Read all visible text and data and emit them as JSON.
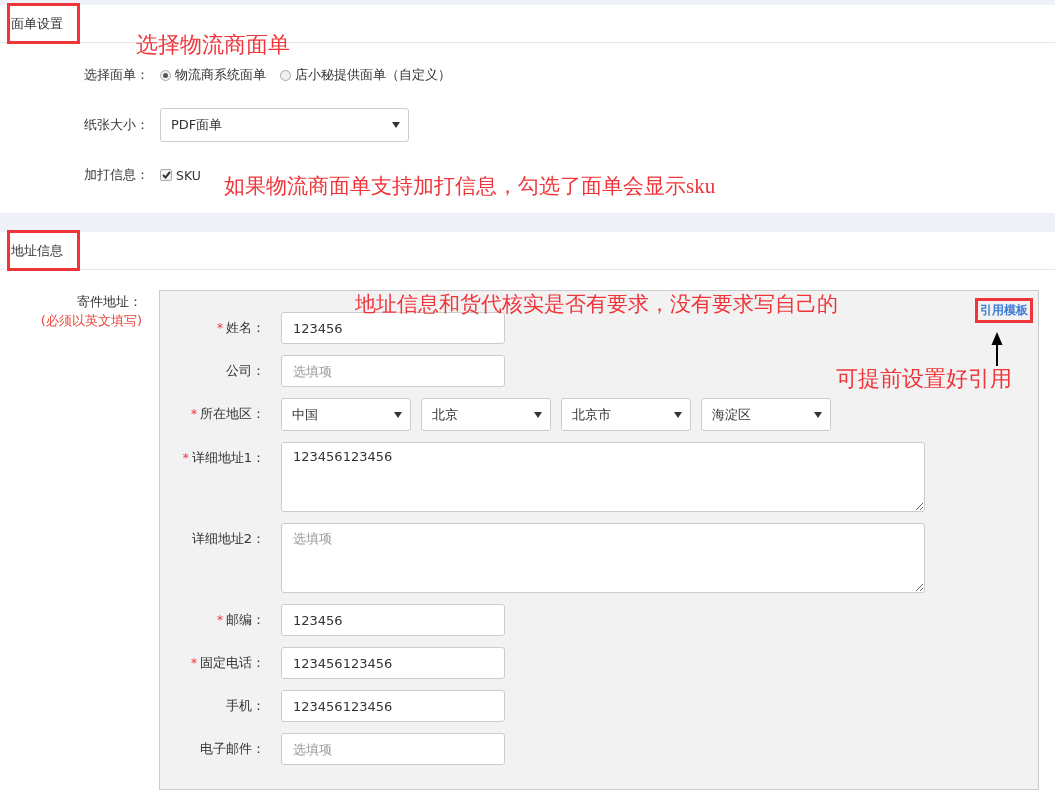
{
  "sections": [
    {
      "title": "面单设置",
      "highlighted": true
    },
    {
      "title": "地址信息",
      "highlighted": true
    }
  ],
  "waybill": {
    "choice_label": "选择面单：",
    "options": [
      {
        "label": "物流商系统面单",
        "selected": true
      },
      {
        "label": "店小秘提供面单（自定义）",
        "selected": false
      }
    ],
    "paper_label": "纸张大小：",
    "paper_value": "PDF面单",
    "extra_label": "加打信息：",
    "extra_option": {
      "label": "SKU",
      "checked": true
    }
  },
  "address": {
    "label": "寄件地址：",
    "note": "(必须以英文填写)",
    "template_button": {
      "label": "引用模板",
      "highlighted": true
    },
    "fields": [
      {
        "kind": "text",
        "marker": "*",
        "label": "姓名：",
        "value": "123456"
      },
      {
        "kind": "text",
        "label": "公司：",
        "placeholder": "选填项"
      },
      {
        "kind": "select-group",
        "marker": "*",
        "label": "所在地区：",
        "selects": [
          "中国",
          "北京",
          "北京市",
          "海淀区"
        ]
      },
      {
        "kind": "textarea",
        "marker": "*",
        "label": "详细地址1：",
        "value": "123456123456"
      },
      {
        "kind": "textarea",
        "label": "详细地址2：",
        "placeholder": "选填项"
      },
      {
        "kind": "text",
        "marker": "*",
        "label": "邮编：",
        "value": "123456"
      },
      {
        "kind": "text",
        "marker": "*",
        "label": "固定电话：",
        "value": "123456123456"
      },
      {
        "kind": "text",
        "label": "手机：",
        "value": "123456123456"
      },
      {
        "kind": "text",
        "label": "电子邮件：",
        "placeholder": "选填项"
      }
    ]
  },
  "annotations": [
    "选择物流商面单",
    "如果物流商面单支持加打信息，勾选了面单会显示sku",
    "地址信息和货代核实是否有要求，没有要求写自己的",
    "可提前设置好引用"
  ]
}
